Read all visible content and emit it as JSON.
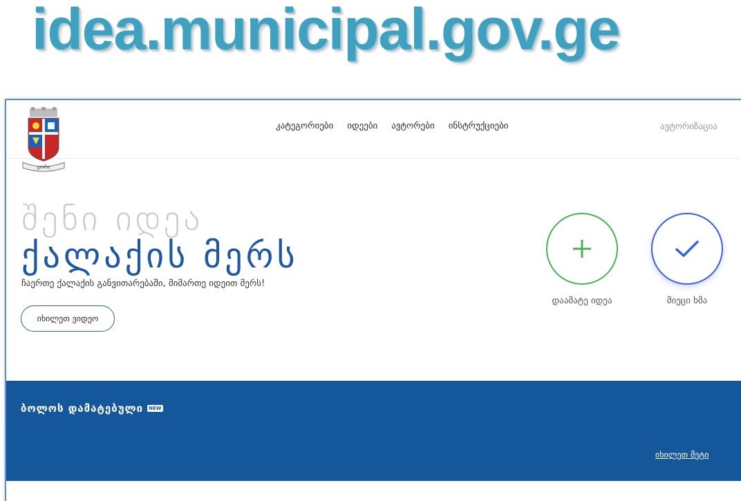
{
  "headline": "idea.municipal.gov.ge",
  "nav": {
    "items": [
      {
        "label": "კატეგორიები"
      },
      {
        "label": "იდეები"
      },
      {
        "label": "ავტორები"
      },
      {
        "label": "ინსტრუქციები"
      }
    ],
    "auth_label": "ავტორიზაცია"
  },
  "logo": {
    "banner_text": "გორი"
  },
  "hero": {
    "line1": "შენი იდეა",
    "line2": "ქალაქის მერს",
    "subtitle": "ჩაერთე ქალაქის განვითარებაში, მიმართე იდეით მერს!",
    "video_button": "იხილეთ ვიდეო"
  },
  "actions": {
    "add": {
      "label": "დაამატე იდეა",
      "icon": "plus-icon",
      "color": "#4caf50"
    },
    "vote": {
      "label": "მიეცი ხმა",
      "icon": "check-icon",
      "color": "#3a5fe5"
    }
  },
  "recent": {
    "title": "ბოლოს დამატებული",
    "badge": "NEW",
    "see_more": "იხილეთ მეტი",
    "band_color": "#14579b"
  }
}
